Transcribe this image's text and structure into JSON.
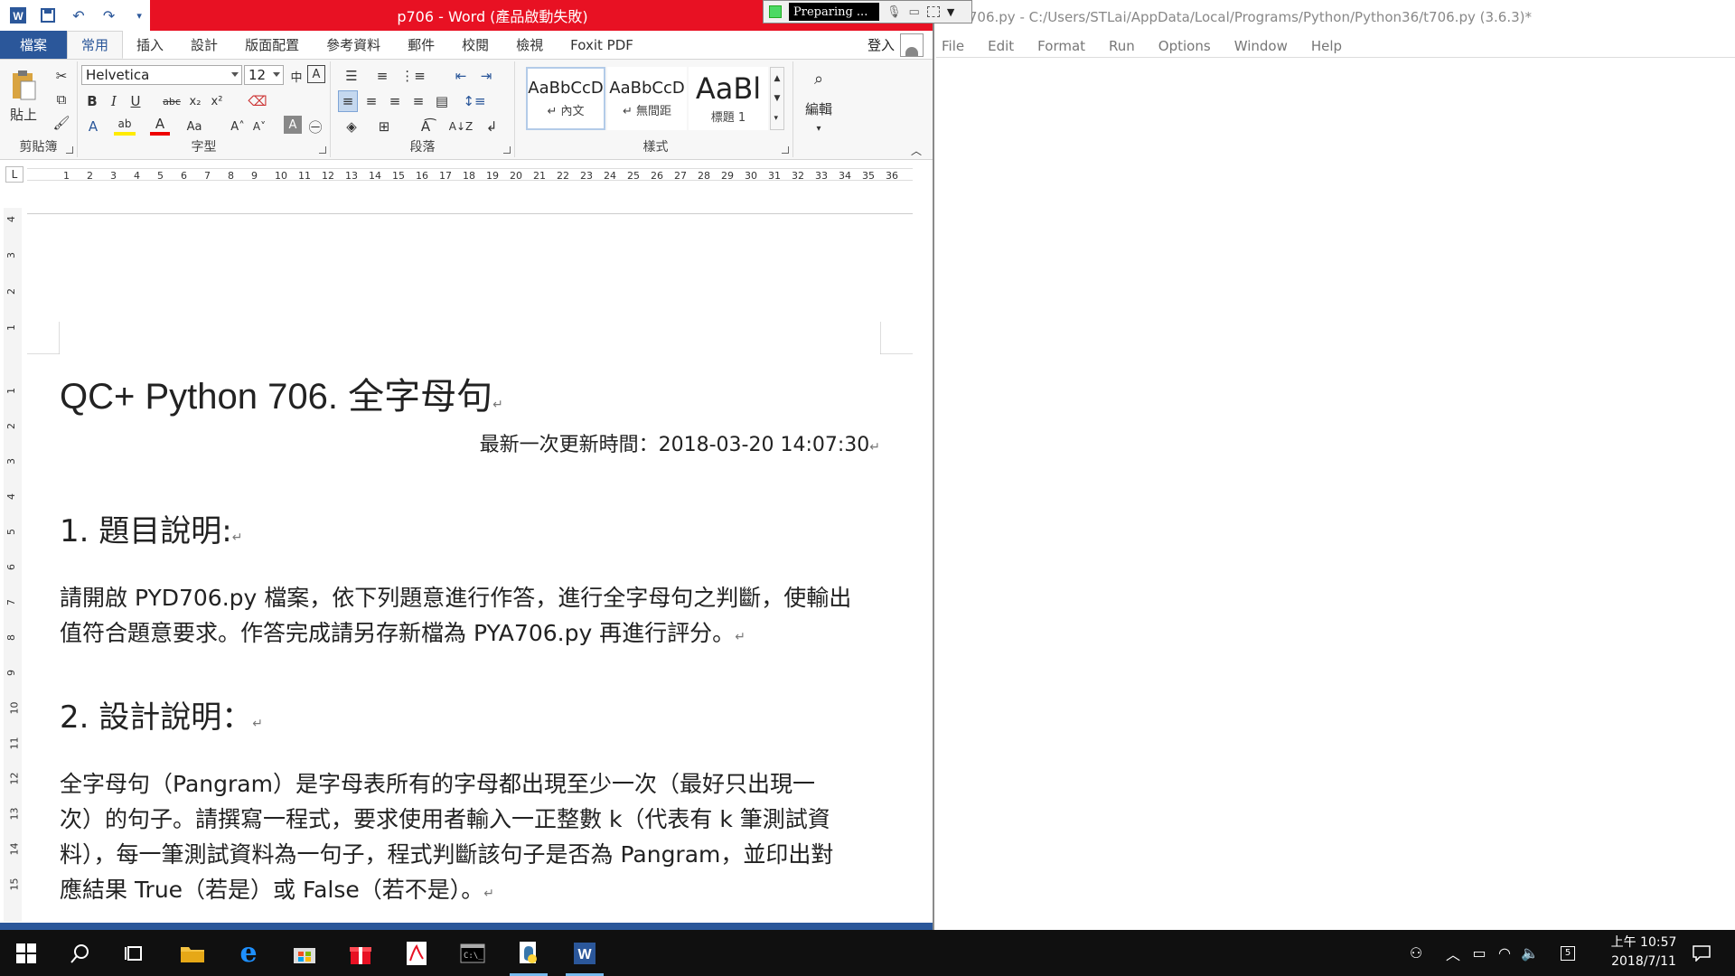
{
  "word": {
    "title": "p706 - Word (產品啟動失敗)",
    "tabs": [
      "檔案",
      "常用",
      "插入",
      "設計",
      "版面配置",
      "參考資料",
      "郵件",
      "校閱",
      "檢視",
      "Foxit PDF"
    ],
    "login": "登入",
    "ribbon": {
      "clipboard": {
        "paste_label": "貼上",
        "group_label": "剪貼簿"
      },
      "font": {
        "name": "Helvetica",
        "size": "12",
        "group_label": "字型"
      },
      "paragraph": {
        "group_label": "段落"
      },
      "styles": {
        "group_label": "樣式",
        "items": [
          {
            "sample": "AaBbCcD",
            "name": "↵ 內文"
          },
          {
            "sample": "AaBbCcD",
            "name": "↵ 無間距"
          },
          {
            "sample": "AaBl",
            "name": "標題 1"
          }
        ]
      },
      "editing": {
        "label": "編輯"
      }
    },
    "doc": {
      "title": "QC+ Python 706.  全字母句",
      "updated": "最新一次更新時間：2018-03-20 14:07:30",
      "section1": "1.  題目說明:",
      "para1_line1": "請開啟 PYD706.py 檔案，依下列題意進行作答，進行全字母句之判斷，使輸出",
      "para1_line2": "值符合題意要求。作答完成請另存新檔為 PYA706.py 再進行評分。",
      "section2": "2.  設計說明：",
      "para2_line1": "全字母句（Pangram）是字母表所有的字母都出現至少一次（最好只出現一",
      "para2_line2": "次）的句子。請撰寫一程式，要求使用者輸入一正整數 k（代表有 k 筆測試資",
      "para2_line3": "料），每一筆測試資料為一句子，程式判斷該句子是否為 Pangram，並印出對",
      "para2_line4": "應結果 True（若是）或 False（若不是）。",
      "para_mark": "↵"
    }
  },
  "idle": {
    "title": "t706.py - C:/Users/STLai/AppData/Local/Programs/Python/Python36/t706.py (3.6.3)*",
    "menu": [
      "File",
      "Edit",
      "Format",
      "Run",
      "Options",
      "Window",
      "Help"
    ]
  },
  "recorder": {
    "status": "Preparing ..."
  },
  "taskbar": {
    "time": "上午 10:57",
    "date": "2018/7/11"
  },
  "colors": {
    "word_blue": "#2b579a",
    "title_red": "#e81123",
    "taskbar": "#101010"
  }
}
